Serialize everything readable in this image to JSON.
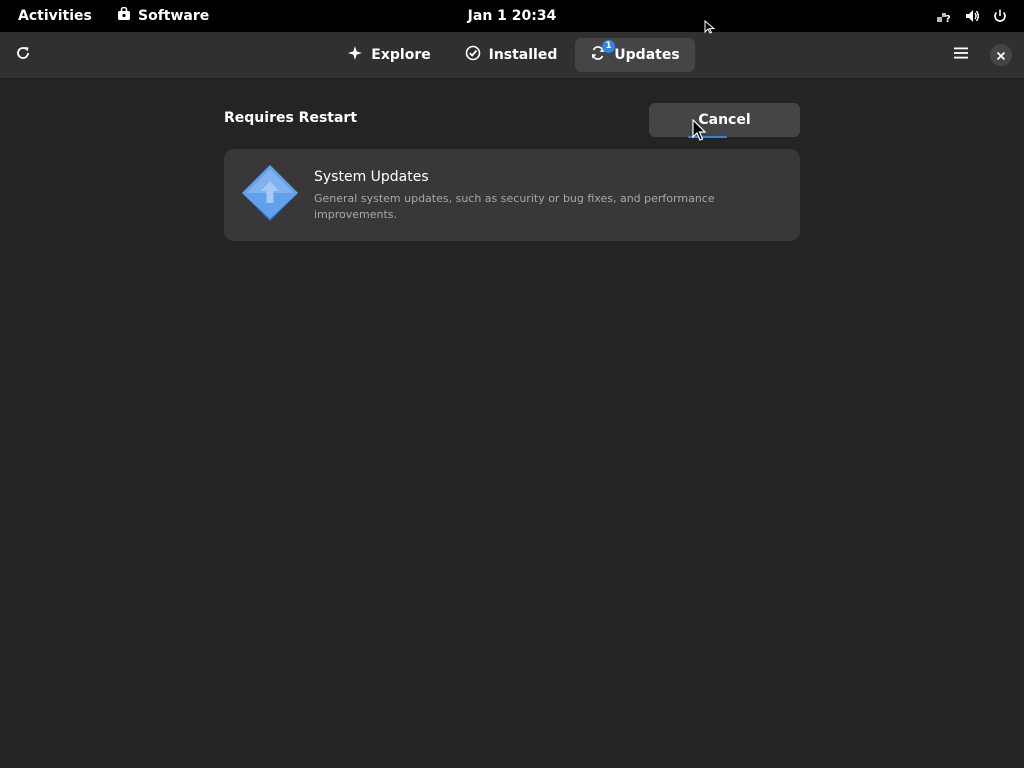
{
  "topbar": {
    "activities": "Activities",
    "app_name": "Software",
    "clock": "Jan 1  20:34",
    "tray_icons": [
      "network-unknown-icon",
      "volume-icon",
      "power-icon"
    ]
  },
  "header": {
    "refresh_icon": "refresh-icon",
    "tabs": [
      {
        "label": "Explore",
        "icon": "explore-star-icon"
      },
      {
        "label": "Installed",
        "icon": "check-circle-icon"
      },
      {
        "label": "Updates",
        "icon": "sync-icon",
        "badge": "1",
        "active": true
      }
    ],
    "menu_icon": "hamburger-menu-icon",
    "close_icon": "close-icon"
  },
  "main": {
    "section_title": "Requires Restart",
    "cancel_label": "Cancel",
    "update_card": {
      "title": "System Updates",
      "description": "General system updates, such as security or bug fixes, and performance improvements.",
      "icon": "system-update-arrow-icon"
    }
  },
  "colors": {
    "accent": "#3584e4",
    "background": "#242424",
    "card": "#383838",
    "topbar": "#000000"
  }
}
